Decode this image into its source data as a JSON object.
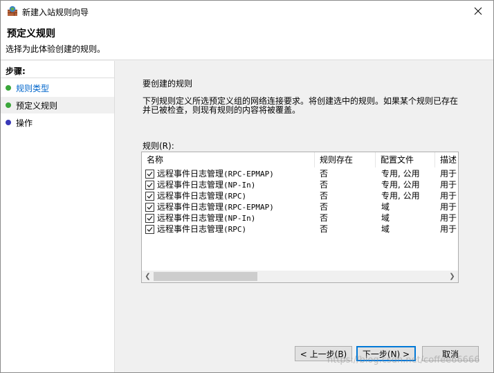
{
  "window": {
    "title": "新建入站规则向导",
    "icon": "firewall-wizard-icon",
    "close_icon": "close-icon"
  },
  "header": {
    "title": "预定义规则",
    "subtitle": "选择为此体验创建的规则。"
  },
  "steps": {
    "header": "步骤:",
    "items": [
      {
        "label": "规则类型",
        "state": "done",
        "dot_color": "#3aa63a"
      },
      {
        "label": "预定义规则",
        "state": "current",
        "dot_color": "#3aa63a"
      },
      {
        "label": "操作",
        "state": "pending",
        "dot_color": "#3a3ab8"
      }
    ]
  },
  "content": {
    "heading": "要创建的规则",
    "description": "下列规则定义所选预定义组的网络连接要求。将创建选中的规则。如果某个规则已存在并已被检查，则现有规则的内容将被覆盖。",
    "rules_label": "规则(R):"
  },
  "table": {
    "columns": [
      "名称",
      "规则存在",
      "配置文件",
      "描述"
    ],
    "rows": [
      {
        "checked": true,
        "name_prefix": "远程事件日志管理",
        "name_suffix": "(RPC-EPMAP)",
        "exists": "否",
        "profile": "专用, 公用",
        "desc": "用于"
      },
      {
        "checked": true,
        "name_prefix": "远程事件日志管理",
        "name_suffix": "(NP-In)",
        "exists": "否",
        "profile": "专用, 公用",
        "desc": "用于"
      },
      {
        "checked": true,
        "name_prefix": "远程事件日志管理",
        "name_suffix": "(RPC)",
        "exists": "否",
        "profile": "专用, 公用",
        "desc": "用于"
      },
      {
        "checked": true,
        "name_prefix": "远程事件日志管理",
        "name_suffix": "(RPC-EPMAP)",
        "exists": "否",
        "profile": "域",
        "desc": "用于"
      },
      {
        "checked": true,
        "name_prefix": "远程事件日志管理",
        "name_suffix": "(NP-In)",
        "exists": "否",
        "profile": "域",
        "desc": "用于"
      },
      {
        "checked": true,
        "name_prefix": "远程事件日志管理",
        "name_suffix": "(RPC)",
        "exists": "否",
        "profile": "域",
        "desc": "用于"
      }
    ]
  },
  "buttons": {
    "back": "< 上一步(B)",
    "next": "下一步(N) >",
    "cancel": "取消"
  },
  "watermark": "https://blog.csdn.net/coffee66666",
  "colors": {
    "accent": "#0078d7",
    "link": "#0066cc"
  }
}
